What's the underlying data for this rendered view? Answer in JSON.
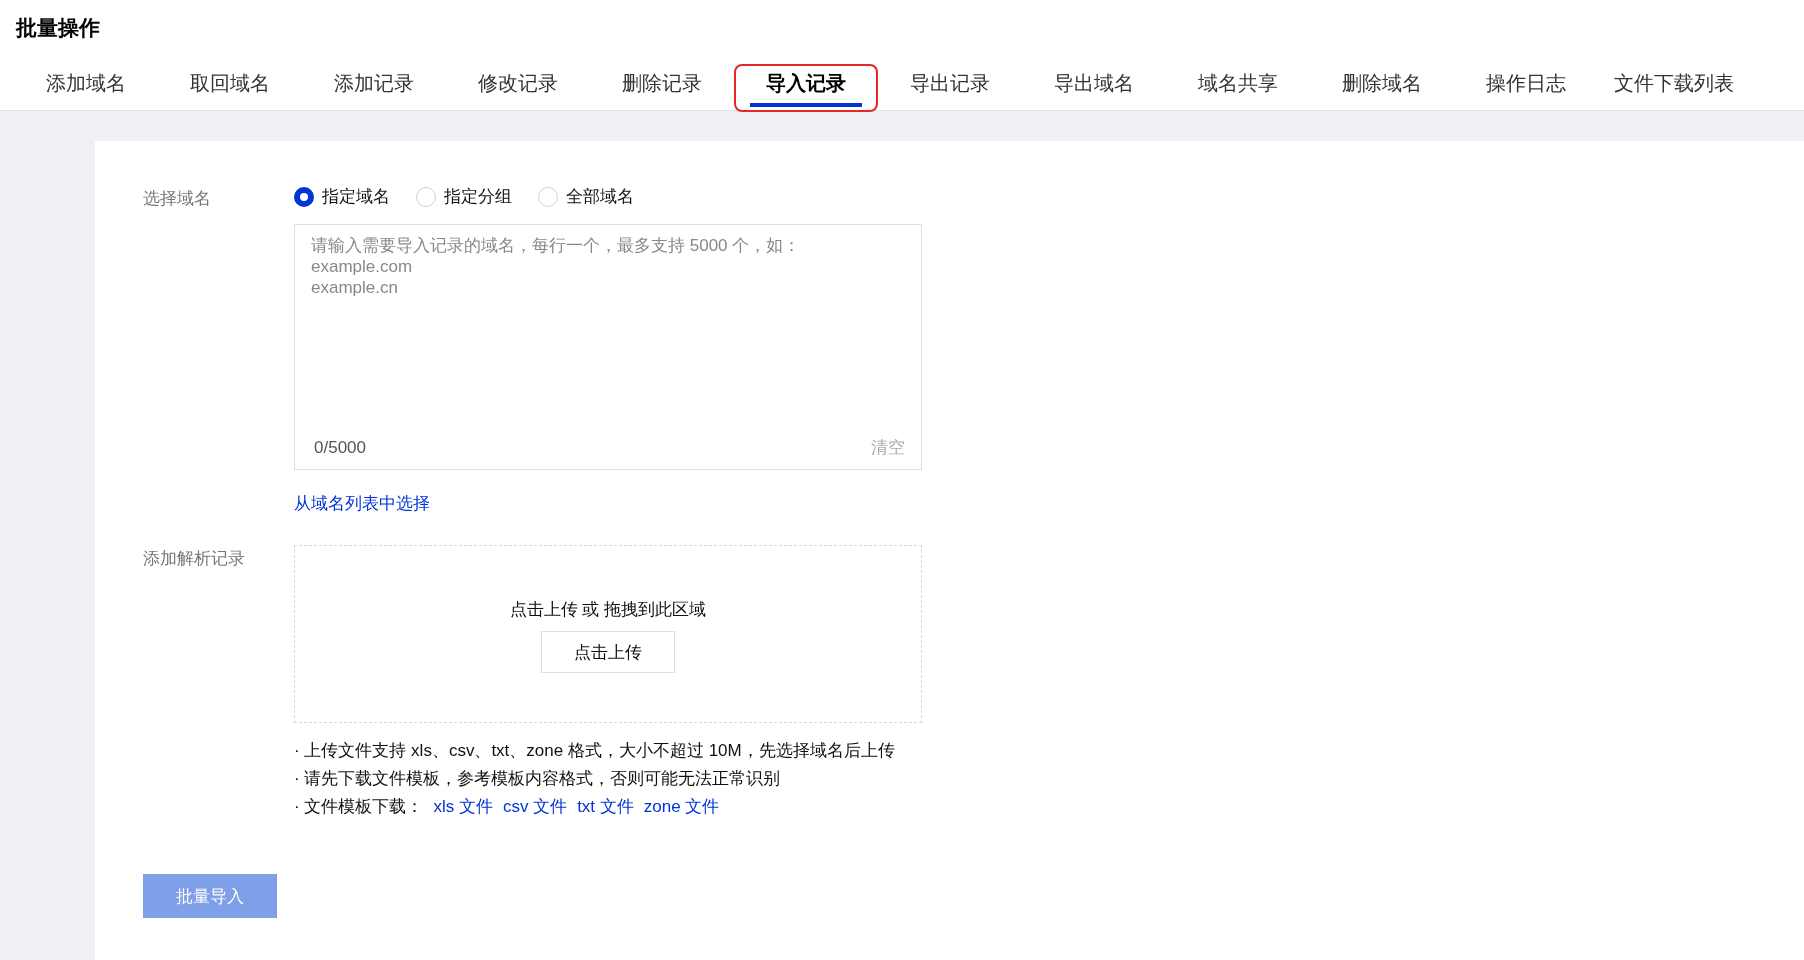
{
  "title": "批量操作",
  "tabs": [
    {
      "label": "添加域名",
      "selected": false
    },
    {
      "label": "取回域名",
      "selected": false
    },
    {
      "label": "添加记录",
      "selected": false
    },
    {
      "label": "修改记录",
      "selected": false
    },
    {
      "label": "删除记录",
      "selected": false
    },
    {
      "label": "导入记录",
      "selected": true
    },
    {
      "label": "导出记录",
      "selected": false
    },
    {
      "label": "导出域名",
      "selected": false
    },
    {
      "label": "域名共享",
      "selected": false
    },
    {
      "label": "删除域名",
      "selected": false
    },
    {
      "label": "操作日志",
      "selected": false
    },
    {
      "label": "文件下载列表",
      "selected": false
    }
  ],
  "domain_select": {
    "label": "选择域名",
    "options": [
      {
        "label": "指定域名",
        "selected": true
      },
      {
        "label": "指定分组",
        "selected": false
      },
      {
        "label": "全部域名",
        "selected": false
      }
    ],
    "textarea": {
      "placeholder": "请输入需要导入记录的域名，每行一个，最多支持 5000 个，如：\nexample.com\nexample.cn",
      "counter": "0/5000",
      "clear": "清空"
    },
    "link": "从域名列表中选择"
  },
  "records": {
    "label": "添加解析记录",
    "dropzone": {
      "hint": "点击上传 或 拖拽到此区域",
      "button": "点击上传"
    },
    "notes": [
      {
        "text": "· 上传文件支持 xls、csv、txt、zone 格式，大小不超过 10M，先选择域名后上传"
      },
      {
        "text": "· 请先下载文件模板，参考模板内容格式，否则可能无法正常识别"
      },
      {
        "text": "· 文件模板下载：",
        "links": [
          "xls 文件",
          "csv 文件",
          "txt 文件",
          "zone 文件"
        ]
      }
    ]
  },
  "submit": {
    "label": "批量导入",
    "disabled": true
  }
}
